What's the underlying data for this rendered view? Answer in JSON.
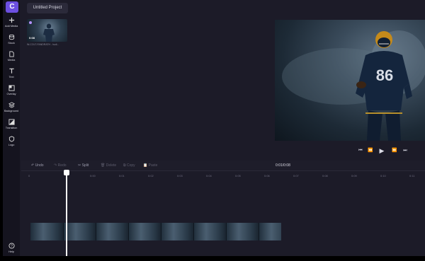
{
  "app": {
    "logo_letter": "C",
    "project_title": "Untitled Project"
  },
  "sidebar": {
    "items": [
      {
        "label": "Add Media",
        "icon": "plus-icon"
      },
      {
        "label": "Stock",
        "icon": "stock-icon"
      },
      {
        "label": "Media",
        "icon": "media-icon"
      },
      {
        "label": "Text",
        "icon": "text-icon"
      },
      {
        "label": "Overlay",
        "icon": "overlay-icon"
      },
      {
        "label": "Background",
        "icon": "background-icon"
      },
      {
        "label": "Transition",
        "icon": "transition-icon"
      },
      {
        "label": "Logo",
        "icon": "logo-icon"
      }
    ],
    "help": {
      "label": "Help",
      "icon": "help-icon"
    }
  },
  "media": {
    "duration": "0:08",
    "filename": "W-COLT-FANDRATH - Isoli..."
  },
  "preview": {
    "jersey_number": "86"
  },
  "player": {
    "controls": [
      "skip-back",
      "rewind",
      "play",
      "fast-forward",
      "skip-forward"
    ]
  },
  "toolbar": {
    "undo": "Undo",
    "redo": "Redo",
    "split": "Split",
    "delete": "Delete",
    "copy": "Copy",
    "paste": "Paste",
    "time": "0:01/0:08"
  },
  "ruler": {
    "ticks": [
      "0",
      "0:00",
      "0:01",
      "0:02",
      "0:03",
      "0:04",
      "0:05",
      "0:06",
      "0:07",
      "0:08",
      "0:09",
      "0:10",
      "0:11",
      "0:12",
      "0:13"
    ]
  },
  "colors": {
    "accent": "#6c4fe0",
    "background": "#1c1b28",
    "sidebar": "#15141f",
    "playhead": "#ffffff"
  }
}
